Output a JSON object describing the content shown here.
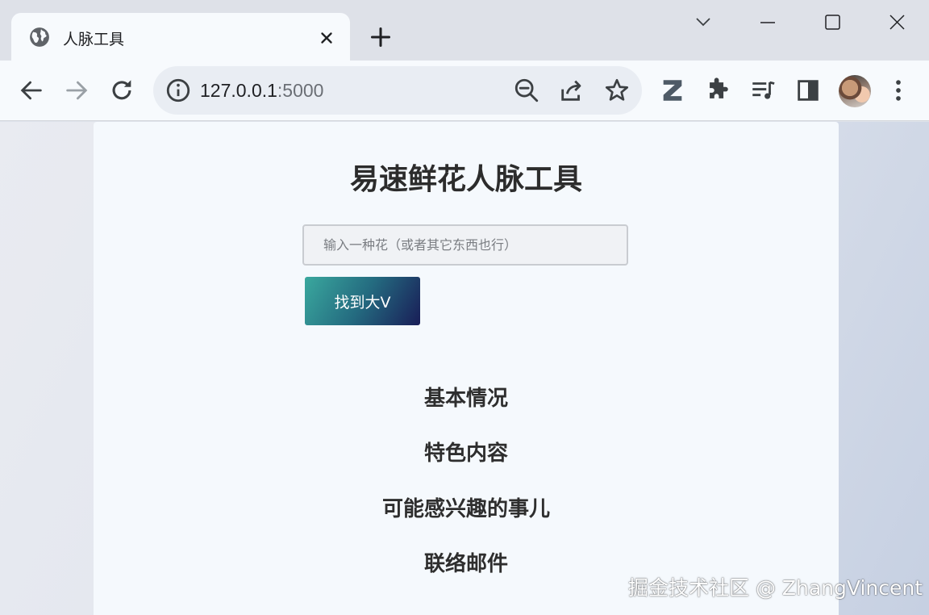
{
  "browser": {
    "tab": {
      "title": "人脉工具",
      "icon": "globe-icon"
    },
    "address": {
      "host": "127.0.0.1",
      "port": ":5000"
    },
    "toolbar_icons": [
      "back-icon",
      "forward-icon",
      "reload-icon",
      "info-icon",
      "zoom-out-icon",
      "share-icon",
      "star-icon",
      "z-extension-icon",
      "extensions-icon",
      "media-icon",
      "side-panel-icon",
      "avatar",
      "menu-icon"
    ]
  },
  "page": {
    "title": "易速鲜花人脉工具",
    "input": {
      "placeholder": "输入一种花（或者其它东西也行）",
      "value": ""
    },
    "button_label": "找到大V",
    "button_gradient": [
      "#3aa89e",
      "#191d57"
    ],
    "sections": [
      "基本情况",
      "特色内容",
      "可能感兴趣的事儿",
      "联络邮件"
    ]
  },
  "watermark": "掘金技术社区 @ ZhangVincent"
}
